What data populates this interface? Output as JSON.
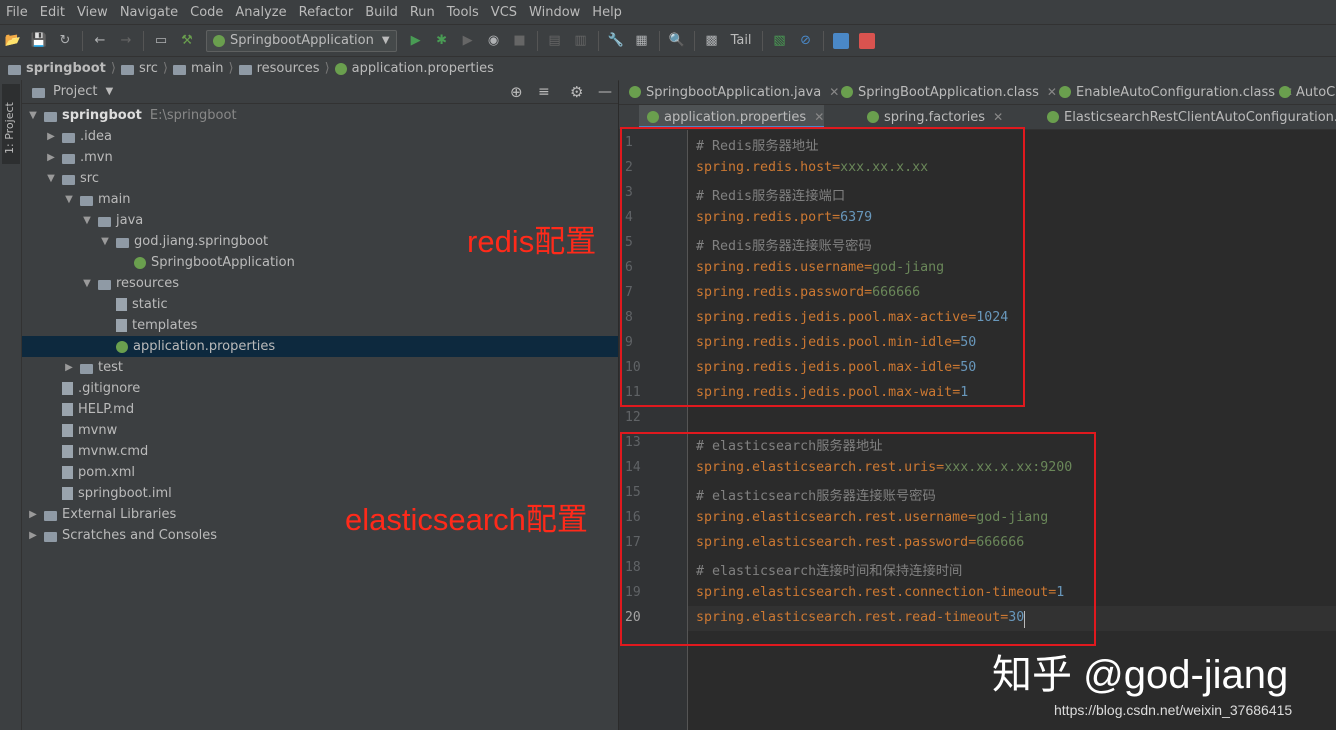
{
  "menu": [
    "File",
    "Edit",
    "View",
    "Navigate",
    "Code",
    "Analyze",
    "Refactor",
    "Build",
    "Run",
    "Tools",
    "VCS",
    "Window",
    "Help"
  ],
  "toolbar": {
    "run_config": "SpringbootApplication",
    "tail_label": "Tail"
  },
  "breadcrumb": [
    "springboot",
    "src",
    "main",
    "resources",
    "application.properties"
  ],
  "project": {
    "header_label": "Project",
    "side_tab": "1: Project",
    "tree": [
      {
        "label": "springboot",
        "sub": "E:\\springboot",
        "depth": 0,
        "arrow": "down",
        "bold": true
      },
      {
        "label": ".idea",
        "depth": 1,
        "arrow": "right"
      },
      {
        "label": ".mvn",
        "depth": 1,
        "arrow": "right"
      },
      {
        "label": "src",
        "depth": 1,
        "arrow": "down"
      },
      {
        "label": "main",
        "depth": 2,
        "arrow": "down"
      },
      {
        "label": "java",
        "depth": 3,
        "arrow": "down"
      },
      {
        "label": "god.jiang.springboot",
        "depth": 4,
        "arrow": "down"
      },
      {
        "label": "SpringbootApplication",
        "depth": 5,
        "arrow": ""
      },
      {
        "label": "resources",
        "depth": 3,
        "arrow": "down"
      },
      {
        "label": "static",
        "depth": 4,
        "arrow": ""
      },
      {
        "label": "templates",
        "depth": 4,
        "arrow": ""
      },
      {
        "label": "application.properties",
        "depth": 4,
        "arrow": "",
        "selected": true
      },
      {
        "label": "test",
        "depth": 2,
        "arrow": "right"
      },
      {
        "label": ".gitignore",
        "depth": 1,
        "arrow": ""
      },
      {
        "label": "HELP.md",
        "depth": 1,
        "arrow": ""
      },
      {
        "label": "mvnw",
        "depth": 1,
        "arrow": ""
      },
      {
        "label": "mvnw.cmd",
        "depth": 1,
        "arrow": ""
      },
      {
        "label": "pom.xml",
        "depth": 1,
        "arrow": ""
      },
      {
        "label": "springboot.iml",
        "depth": 1,
        "arrow": ""
      },
      {
        "label": "External Libraries",
        "depth": 0,
        "arrow": "right"
      },
      {
        "label": "Scratches and Consoles",
        "depth": 0,
        "arrow": "right"
      }
    ]
  },
  "tabs_row1": [
    "SpringbootApplication.java",
    "SpringBootApplication.class",
    "EnableAutoConfiguration.class",
    "AutoC"
  ],
  "tabs_row2": [
    "application.properties",
    "spring.factories",
    "ElasticsearchRestClientAutoConfiguration.class"
  ],
  "code": [
    {
      "n": "1",
      "type": "comment",
      "text": "# Redis服务器地址"
    },
    {
      "n": "2",
      "key": "spring.redis.host",
      "val": "xxx.xx.x.xx",
      "vtype": "str"
    },
    {
      "n": "3",
      "type": "comment",
      "text": "# Redis服务器连接端口"
    },
    {
      "n": "4",
      "key": "spring.redis.port",
      "val": "6379",
      "vtype": "num"
    },
    {
      "n": "5",
      "type": "comment",
      "text": "# Redis服务器连接账号密码"
    },
    {
      "n": "6",
      "key": "spring.redis.username",
      "val": "god-jiang",
      "vtype": "str"
    },
    {
      "n": "7",
      "key": "spring.redis.password",
      "val": "666666",
      "vtype": "str"
    },
    {
      "n": "8",
      "key": "spring.redis.jedis.pool.max-active",
      "val": "1024",
      "vtype": "num"
    },
    {
      "n": "9",
      "key": "spring.redis.jedis.pool.min-idle",
      "val": "50",
      "vtype": "num"
    },
    {
      "n": "10",
      "key": "spring.redis.jedis.pool.max-idle",
      "val": "50",
      "vtype": "num"
    },
    {
      "n": "11",
      "key": "spring.redis.jedis.pool.max-wait",
      "val": "1",
      "vtype": "num"
    },
    {
      "n": "12",
      "type": "blank",
      "text": ""
    },
    {
      "n": "13",
      "type": "comment",
      "text": "# elasticsearch服务器地址"
    },
    {
      "n": "14",
      "key": "spring.elasticsearch.rest.uris",
      "val": "xxx.xx.x.xx:9200",
      "vtype": "str"
    },
    {
      "n": "15",
      "type": "comment",
      "text": "# elasticsearch服务器连接账号密码"
    },
    {
      "n": "16",
      "key": "spring.elasticsearch.rest.username",
      "val": "god-jiang",
      "vtype": "str"
    },
    {
      "n": "17",
      "key": "spring.elasticsearch.rest.password",
      "val": "666666",
      "vtype": "str"
    },
    {
      "n": "18",
      "type": "comment",
      "text": "# elasticsearch连接时间和保持连接时间"
    },
    {
      "n": "19",
      "key": "spring.elasticsearch.rest.connection-timeout",
      "val": "1",
      "vtype": "num"
    },
    {
      "n": "20",
      "key": "spring.elasticsearch.rest.read-timeout",
      "val": "30",
      "vtype": "num"
    }
  ],
  "annotations": {
    "redis": "redis配置",
    "elasticsearch": "elasticsearch配置"
  },
  "watermark": {
    "zhihu": "知乎 @god-jiang",
    "url": "https://blog.csdn.net/weixin_37686415"
  },
  "colors": {
    "accent": "#4a88c7",
    "annotation": "#ff2a1a",
    "key": "#cc7832",
    "string": "#6a8759",
    "number": "#6897bb",
    "comment": "#808080"
  }
}
